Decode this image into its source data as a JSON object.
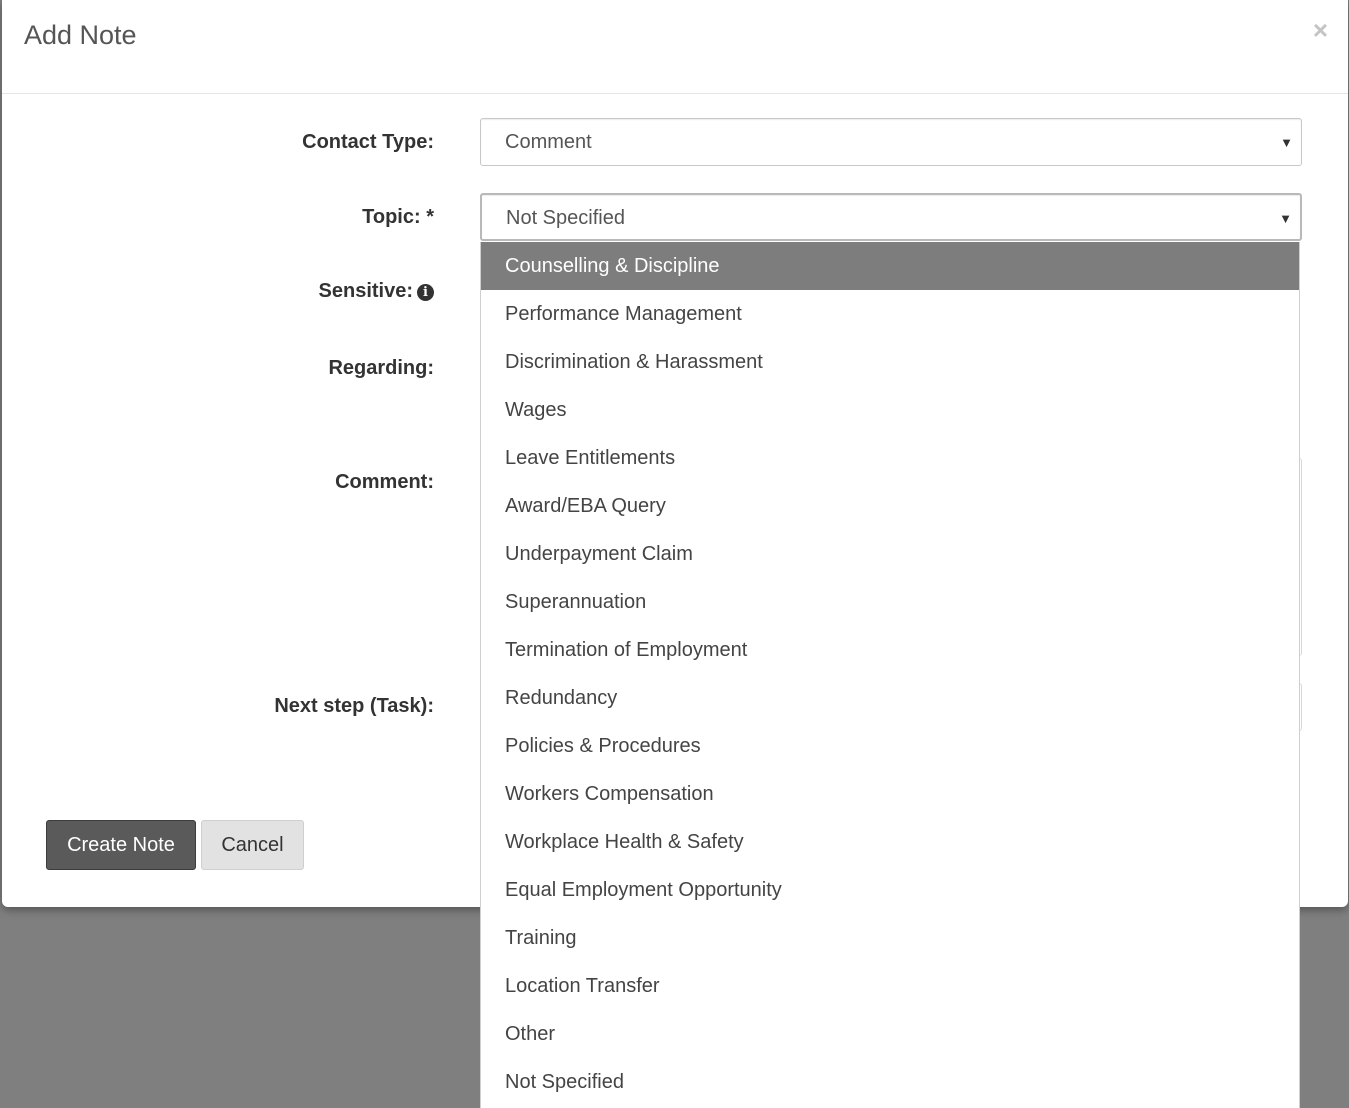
{
  "modal": {
    "title": "Add Note",
    "close_symbol": "×"
  },
  "form": {
    "contact_type": {
      "label": "Contact Type:",
      "value": "Comment"
    },
    "topic": {
      "label": "Topic: *",
      "value": "Not Specified"
    },
    "sensitive": {
      "label": "Sensitive:",
      "info_icon": "info-circle-icon"
    },
    "regarding": {
      "label": "Regarding:"
    },
    "comment": {
      "label": "Comment:"
    },
    "next_step": {
      "label": "Next step (Task):"
    }
  },
  "buttons": {
    "create": "Create Note",
    "cancel": "Cancel"
  },
  "topic_dropdown": {
    "highlighted_index": 0,
    "options": [
      "Counselling & Discipline",
      "Performance Management",
      "Discrimination & Harassment",
      "Wages",
      "Leave Entitlements",
      "Award/EBA Query",
      "Underpayment Claim",
      "Superannuation",
      "Termination of Employment",
      "Redundancy",
      "Policies & Procedures",
      "Workers Compensation",
      "Workplace Health & Safety",
      "Equal Employment Opportunity",
      "Training",
      "Location Transfer",
      "Other",
      "Not Specified"
    ]
  },
  "colors": {
    "primary_button": "#5a5a5a",
    "highlight": "#7d7d7d",
    "backdrop": "#7f7f7f"
  }
}
